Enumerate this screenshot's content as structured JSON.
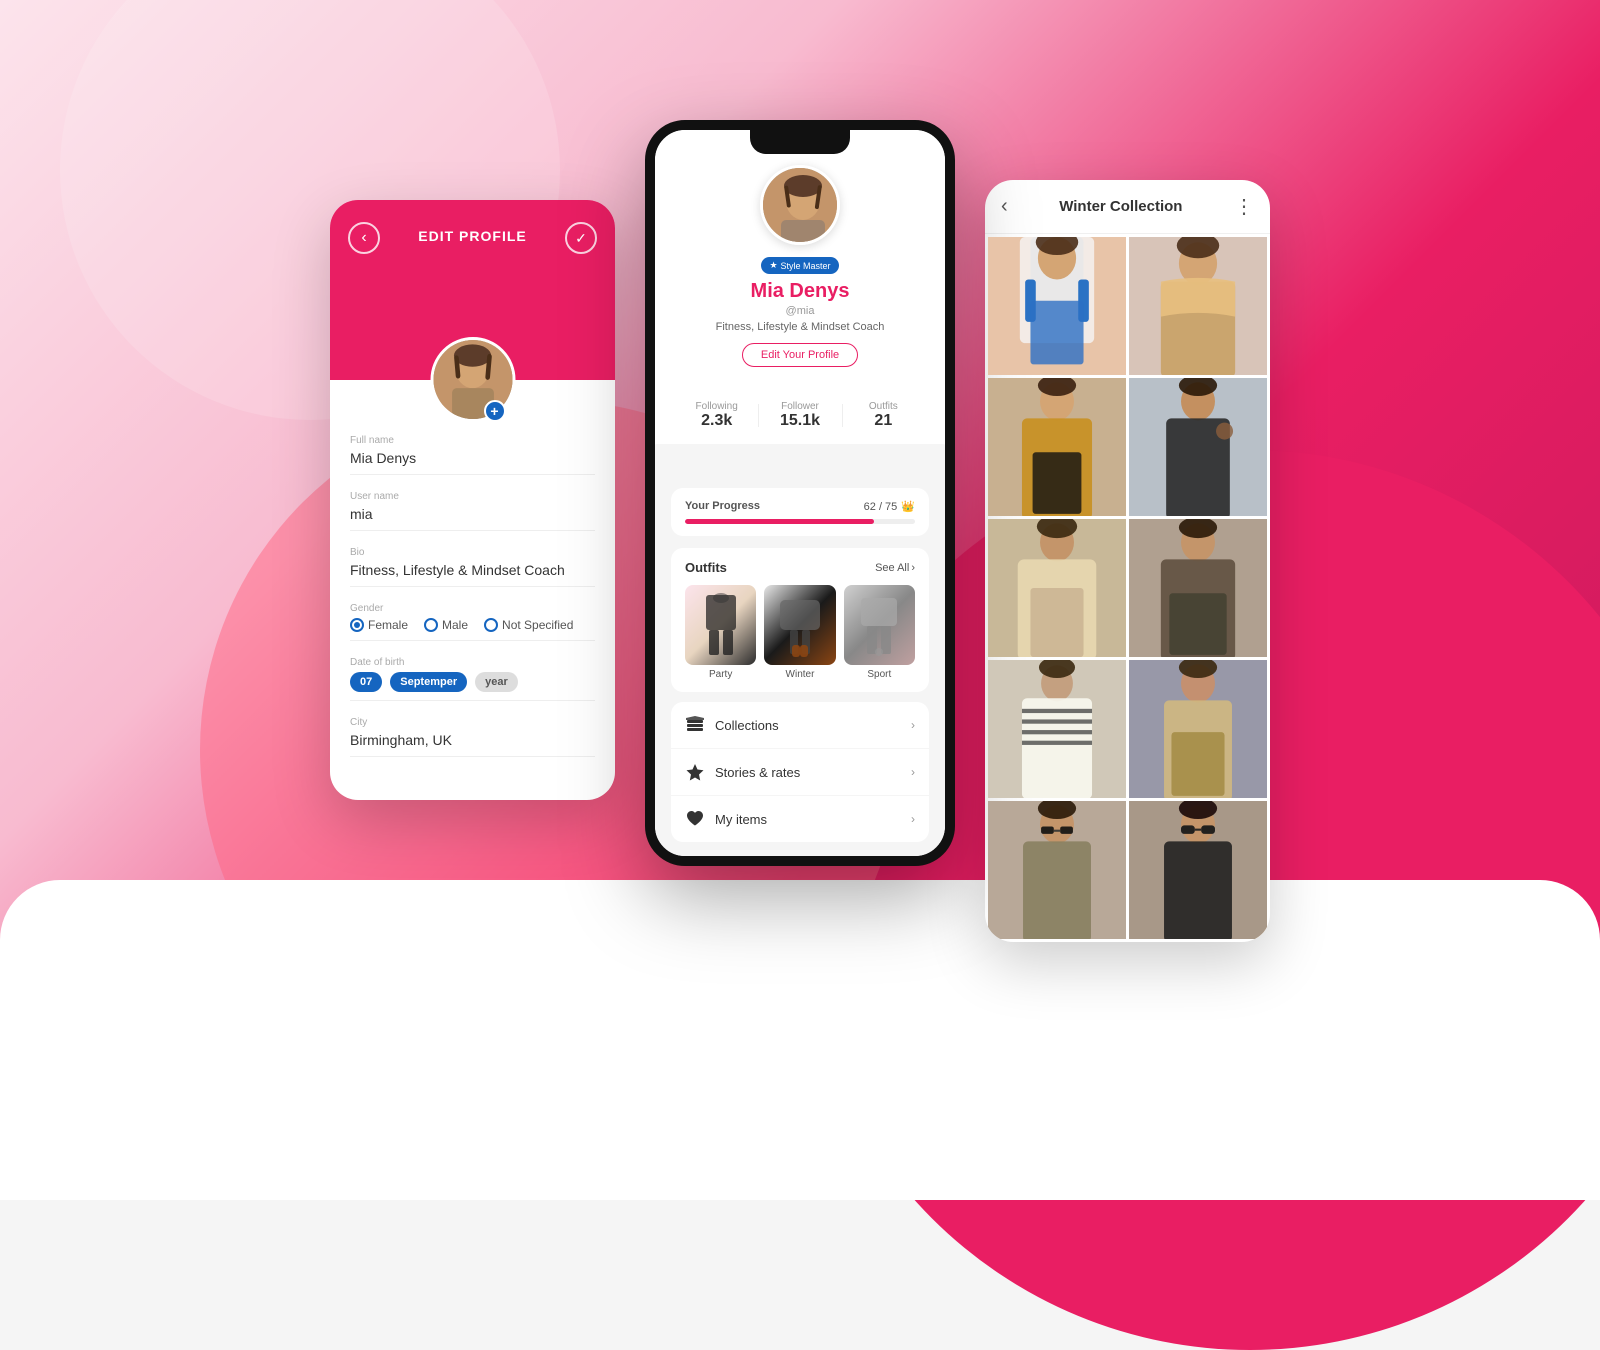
{
  "background": {
    "main_color": "#e91e63"
  },
  "phone_left": {
    "title": "EDIT PROFILE",
    "back_icon": "‹",
    "check_icon": "✓",
    "fields": {
      "full_name_label": "Full name",
      "full_name_value": "Mia Denys",
      "username_label": "User name",
      "username_value": "mia",
      "bio_label": "Bio",
      "bio_value": "Fitness, Lifestyle & Mindset Coach",
      "gender_label": "Gender",
      "gender_options": [
        "Female",
        "Male",
        "Not Specified"
      ],
      "gender_selected": "Female",
      "dob_label": "Date of birth",
      "dob_day": "07",
      "dob_month": "Septemper",
      "dob_year": "year",
      "city_label": "City",
      "city_value": "Birmingham, UK"
    }
  },
  "phone_center": {
    "badge": "Style Master",
    "name": "Mia Denys",
    "username": "@mia",
    "bio": "Fitness, Lifestyle & Mindset Coach",
    "edit_button": "Edit Your Profile",
    "stats": {
      "following_label": "Following",
      "following_value": "2.3k",
      "follower_label": "Follower",
      "follower_value": "15.1k",
      "outfits_label": "Outfits",
      "outfits_value": "21"
    },
    "progress": {
      "label": "Your Progress",
      "current": 62,
      "total": 75,
      "display": "62 / 75",
      "icon": "👑",
      "percent": 82
    },
    "outfits_section": {
      "title": "Outfits",
      "see_all": "See All",
      "items": [
        {
          "label": "Party"
        },
        {
          "label": "Winter"
        },
        {
          "label": "Sport"
        }
      ]
    },
    "menu_items": [
      {
        "icon": "layers",
        "label": "Collections",
        "symbol": "📚"
      },
      {
        "icon": "star",
        "label": "Stories & rates",
        "symbol": "⭐"
      },
      {
        "icon": "heart",
        "label": "My items",
        "symbol": "❤️"
      }
    ]
  },
  "phone_right": {
    "title": "Winter Collection",
    "back_icon": "‹",
    "more_icon": "⋮",
    "photos": [
      {
        "id": 1,
        "alt": "Woman in white top with brown bag"
      },
      {
        "id": 2,
        "alt": "Woman in patterned colorful cardigan"
      },
      {
        "id": 3,
        "alt": "Woman in yellow mustard jacket"
      },
      {
        "id": 4,
        "alt": "Woman in dark outfit with coffee"
      },
      {
        "id": 5,
        "alt": "Woman in beige coat outdoor"
      },
      {
        "id": 6,
        "alt": "Woman in brown coat"
      },
      {
        "id": 7,
        "alt": "Woman in striped top"
      },
      {
        "id": 8,
        "alt": "Woman in casual outfit"
      },
      {
        "id": 9,
        "alt": "Woman in sunglasses"
      },
      {
        "id": 10,
        "alt": "Woman in dark glasses outdoor"
      }
    ]
  }
}
